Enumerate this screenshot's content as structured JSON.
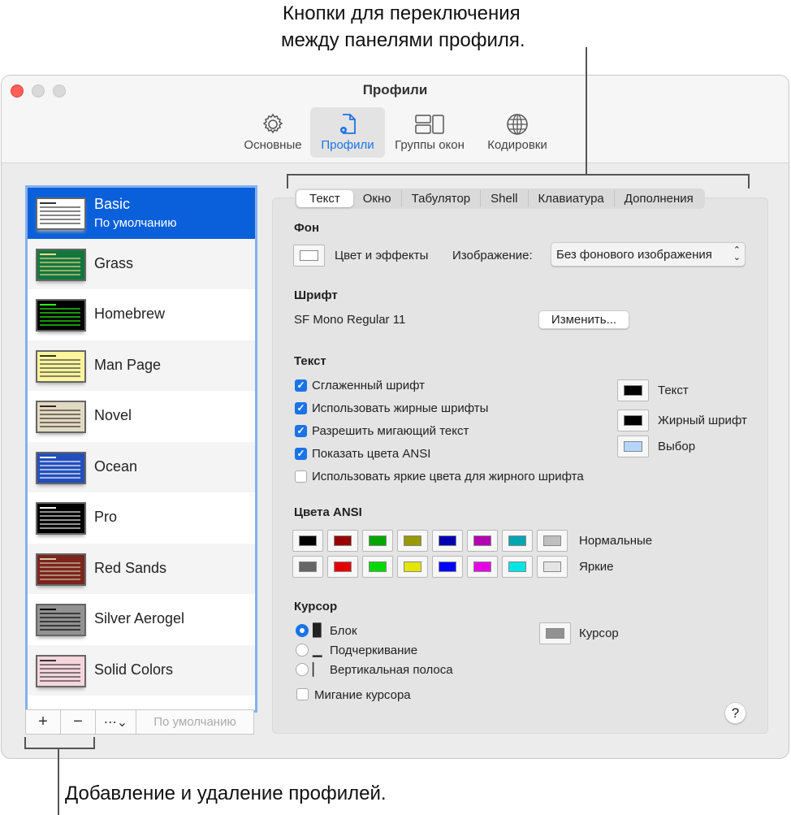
{
  "annotations": {
    "top_line1": "Кнопки для переключения",
    "top_line2": "между панелями профиля.",
    "bottom": "Добавление и удаление профилей."
  },
  "window": {
    "title": "Профили"
  },
  "toolbar": [
    {
      "label": "Основные",
      "icon": "gear-icon"
    },
    {
      "label": "Профили",
      "icon": "profile-doc-icon",
      "selected": true
    },
    {
      "label": "Группы окон",
      "icon": "window-groups-icon"
    },
    {
      "label": "Кодировки",
      "icon": "globe-icon"
    }
  ],
  "profiles": [
    {
      "name": "Basic",
      "subtitle": "По умолчанию",
      "bg": "#ffffff",
      "fg": "#333333",
      "selected": true
    },
    {
      "name": "Grass",
      "bg": "#13773d",
      "fg": "#f0d98c"
    },
    {
      "name": "Homebrew",
      "bg": "#000000",
      "fg": "#28fe14"
    },
    {
      "name": "Man Page",
      "bg": "#fef49c",
      "fg": "#333333"
    },
    {
      "name": "Novel",
      "bg": "#dfdbc3",
      "fg": "#3b2322"
    },
    {
      "name": "Ocean",
      "bg": "#224fbc",
      "fg": "#ffffff"
    },
    {
      "name": "Pro",
      "bg": "#000000",
      "fg": "#f2f2f2"
    },
    {
      "name": "Red Sands",
      "bg": "#7a251e",
      "fg": "#d7c9a7"
    },
    {
      "name": "Silver Aerogel",
      "bg": "#929292",
      "fg": "#000000"
    },
    {
      "name": "Solid Colors",
      "bg": "#f5d5dc",
      "fg": "#333333"
    }
  ],
  "list_buttons": {
    "add": "+",
    "remove": "−",
    "more": "⋯⌄",
    "default": "По умолчанию"
  },
  "tabs": [
    "Текст",
    "Окно",
    "Табулятор",
    "Shell",
    "Клавиатура",
    "Дополнения"
  ],
  "background": {
    "heading": "Фон",
    "color_effects": "Цвет и эффекты",
    "image_label": "Изображение:",
    "image_value": "Без фонового изображения"
  },
  "font": {
    "heading": "Шрифт",
    "value": "SF Mono Regular 11",
    "change": "Изменить..."
  },
  "text": {
    "heading": "Текст",
    "options": [
      {
        "label": "Сглаженный шрифт",
        "checked": true
      },
      {
        "label": "Использовать жирные шрифты",
        "checked": true
      },
      {
        "label": "Разрешить мигающий текст",
        "checked": true
      },
      {
        "label": "Показать цвета ANSI",
        "checked": true
      },
      {
        "label": "Использовать яркие цвета для жирного шрифта",
        "checked": false
      }
    ],
    "colors": [
      {
        "label": "Текст",
        "color": "#000000"
      },
      {
        "label": "Жирный шрифт",
        "color": "#000000"
      },
      {
        "label": "Выбор",
        "color": "#b4d5fe"
      }
    ]
  },
  "ansi": {
    "heading": "Цвета ANSI",
    "normal_label": "Нормальные",
    "bright_label": "Яркие",
    "normal": [
      "#000000",
      "#990000",
      "#00a600",
      "#999900",
      "#0000b2",
      "#b200b2",
      "#00a6b2",
      "#bfbfbf"
    ],
    "bright": [
      "#666666",
      "#e50000",
      "#00d900",
      "#e5e500",
      "#0000ff",
      "#e500e5",
      "#00e5e5",
      "#e5e5e5"
    ]
  },
  "cursor": {
    "heading": "Курсор",
    "options": [
      {
        "glyph": "█",
        "label": "Блок",
        "selected": true
      },
      {
        "glyph": "▁",
        "label": "Подчеркивание"
      },
      {
        "glyph": "▏",
        "label": "Вертикальная полоса"
      }
    ],
    "color_label": "Курсор",
    "color": "#929292",
    "blink": "Мигание курсора",
    "blink_checked": false
  },
  "help": "?"
}
